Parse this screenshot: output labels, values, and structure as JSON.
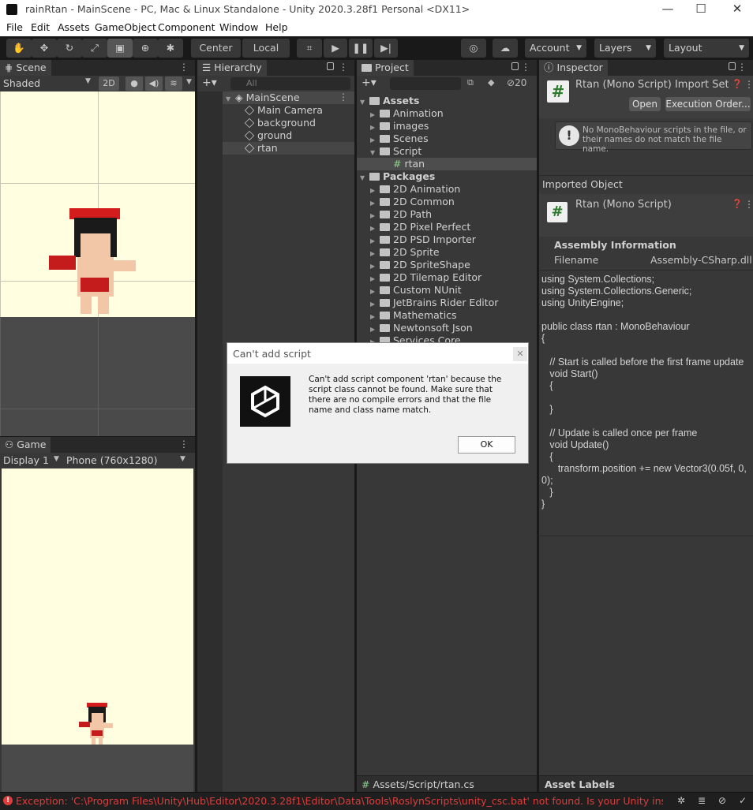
{
  "window": {
    "title": "rainRtan - MainScene - PC, Mac & Linux Standalone - Unity 2020.3.28f1 Personal <DX11>",
    "minimize": "—",
    "maximize": "☐",
    "close": "✕"
  },
  "menu": [
    "File",
    "Edit",
    "Assets",
    "GameObject",
    "Component",
    "Window",
    "Help"
  ],
  "toolbar": {
    "center": "Center",
    "local": "Local",
    "account": "Account",
    "layers": "Layers",
    "layout": "Layout",
    "snap_count": "20"
  },
  "scene": {
    "tab": "Scene",
    "shading": "Shaded",
    "mode2d": "2D"
  },
  "game": {
    "tab": "Game",
    "display": "Display 1",
    "resolution": "Phone (760x1280)"
  },
  "hierarchy": {
    "tab": "Hierarchy",
    "search_placeholder": "All",
    "scene_name": "MainScene",
    "items": [
      "Main Camera",
      "background",
      "ground",
      "rtan"
    ]
  },
  "project": {
    "tab": "Project",
    "assets_label": "Assets",
    "asset_folders": [
      "Animation",
      "images",
      "Scenes",
      "Script"
    ],
    "script_file": "rtan",
    "packages_label": "Packages",
    "packages": [
      "2D Animation",
      "2D Common",
      "2D Path",
      "2D Pixel Perfect",
      "2D PSD Importer",
      "2D Sprite",
      "2D SpriteShape",
      "2D Tilemap Editor",
      "Custom NUnit",
      "JetBrains Rider Editor",
      "Mathematics",
      "Newtonsoft Json",
      "Services Core"
    ],
    "footer_path": "Assets/Script/rtan.cs"
  },
  "inspector": {
    "tab": "Inspector",
    "import_title": "Rtan (Mono Script) Import Sett",
    "open_btn": "Open",
    "exec_order_btn": "Execution Order...",
    "warning": "No MonoBehaviour scripts in the file, or their names do not match the file name.",
    "imported_object": "Imported Object",
    "script_title": "Rtan (Mono Script)",
    "assembly_info": "Assembly Information",
    "filename_label": "Filename",
    "filename_value": "Assembly-CSharp.dll",
    "code": [
      "using System.Collections;",
      "using System.Collections.Generic;",
      "using UnityEngine;",
      "",
      "public class rtan : MonoBehaviour",
      "{",
      "",
      "   // Start is called before the first frame update",
      "   void Start()",
      "   {",
      "",
      "   }",
      "",
      "   // Update is called once per frame",
      "   void Update()",
      "   {",
      "      transform.position += new Vector3(0.05f, 0,",
      "0);",
      "   }",
      "}"
    ],
    "asset_labels": "Asset Labels"
  },
  "dialog": {
    "title": "Can't add script",
    "message": "Can't add script component 'rtan' because the script class cannot be found. Make sure that there are no compile errors and that the file name and class name match.",
    "ok": "OK",
    "close": "✕"
  },
  "status": {
    "error": "Exception: 'C:\\Program Files\\Unity\\Hub\\Editor\\2020.3.28f1\\Editor\\Data\\Tools\\RoslynScripts\\unity_csc.bat' not found. Is your Unity installation corr"
  },
  "colors": {
    "panel": "#383838",
    "dark": "#191919",
    "scene_bg": "#fffee0",
    "error_red": "#e03c3c",
    "selected": "#4d4d4d"
  }
}
